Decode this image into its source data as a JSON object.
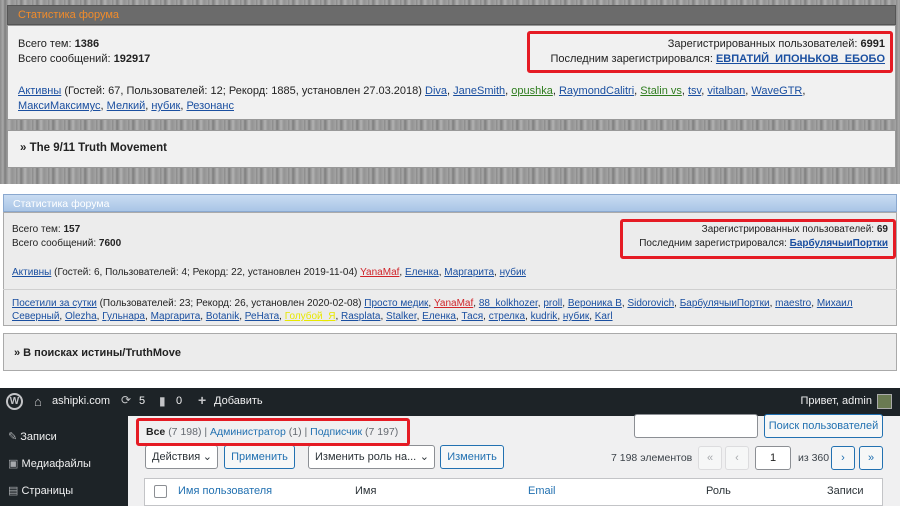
{
  "forum1": {
    "title": "Статистика форума",
    "topics_label": "Всего тем:",
    "topics": "1386",
    "posts_label": "Всего сообщений:",
    "posts": "192917",
    "reg_label": "Зарегистрированных пользователей:",
    "reg": "6991",
    "last_label": "Последним зарегистрировался:",
    "last": "ЕВПАТИЙ_ИПОНЬКОВ_ЕБОБО",
    "active_link": "Активны",
    "active_stats": " (Гостей: 67, Пользователей: 12; Рекорд: 1885, установлен 27.03.2018) ",
    "users": [
      "Diva",
      "JaneSmith",
      "opushka",
      "RaymondCalitri",
      "Stalin vs",
      "tsv",
      "vitalban",
      "WaveGTR",
      "МаксиМаксимус",
      "Мелкий",
      "нубик",
      "Резонанс"
    ],
    "next_forum": "» The 9/11 Truth Movement"
  },
  "forum2": {
    "title": "Статистика форума",
    "topics_label": "Всего тем:",
    "topics": "157",
    "posts_label": "Всего сообщений:",
    "posts": "7600",
    "reg_label": "Зарегистрированных пользователей:",
    "reg": "69",
    "last_label": "Последним зарегистрировался:",
    "last": "БарбулячыиПортки",
    "active_link": "Активны",
    "active_stats": " (Гостей: 6, Пользователей: 4; Рекорд: 22, установлен 2019-11-04) ",
    "active_users": [
      "YanaMaf",
      "Еленка",
      "Маргарита",
      "нубик"
    ],
    "day_link": "Посетили за сутки",
    "day_stats": " (Пользователей: 23; Рекорд: 26, установлен 2020-02-08) ",
    "day_users": [
      "Просто медик",
      "YanaMaf",
      "88_kolkhozer",
      "proll",
      "Вероника В",
      "Sidorovich",
      "БарбулячыиПортки",
      "maestro",
      "Михаил Северный",
      "Olezha",
      "Гульнара",
      "Маргарита",
      "Botanik",
      "РеНата",
      "Голубой_Я",
      "Rasplata",
      "Stalker",
      "Еленка",
      "Тася",
      "стрелка",
      "kudrik",
      "нубик",
      "Karl"
    ],
    "next_forum": "» В поисках истины/TruthMove"
  },
  "wp": {
    "site": "ashipki.com",
    "updates": "5",
    "comments": "0",
    "add_new": "Добавить",
    "greeting": "Привет, admin",
    "menu": [
      "Записи",
      "Медиафайлы",
      "Страницы"
    ],
    "filter_all": "Все",
    "filter_all_count": "(7 198)",
    "filter_admin": "Администратор",
    "filter_admin_count": "(1)",
    "filter_sub": "Подписчик",
    "filter_sub_count": "(7 197)",
    "search_btn": "Поиск пользователей",
    "bulk": "Действия",
    "apply": "Применить",
    "role_select": "Изменить роль на...",
    "change": "Изменить",
    "items": "7 198 элементов",
    "page": "1",
    "of": "из 360",
    "col_user": "Имя пользователя",
    "col_name": "Имя",
    "col_email": "Email",
    "col_role": "Роль",
    "col_posts": "Записи",
    "colors": {
      "bar": "#1d2327",
      "link": "#2271b1",
      "highlight": "#e51b24"
    }
  }
}
